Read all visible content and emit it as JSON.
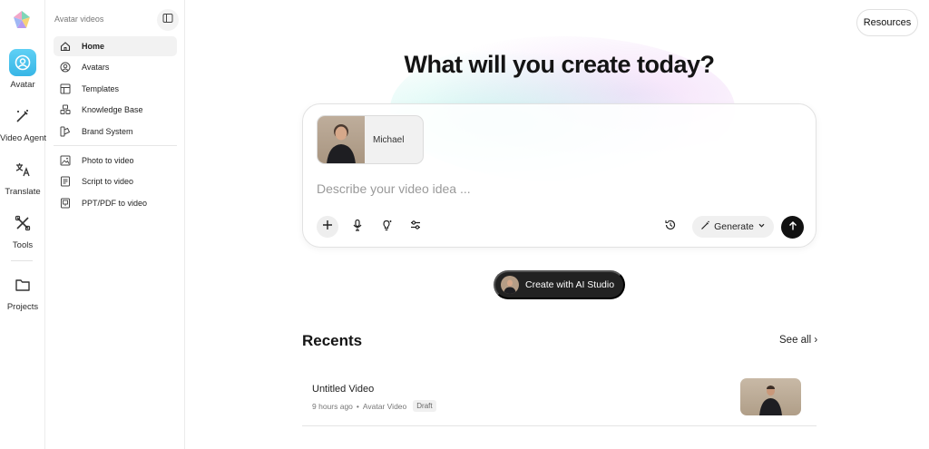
{
  "rail": {
    "items": [
      {
        "label": "Avatar",
        "icon": "avatar-icon"
      },
      {
        "label": "Video Agent",
        "icon": "wand-icon"
      },
      {
        "label": "Translate",
        "icon": "translate-icon"
      },
      {
        "label": "Tools",
        "icon": "tools-icon"
      },
      {
        "label": "Projects",
        "icon": "folder-icon"
      }
    ]
  },
  "sidebar": {
    "title": "Avatar videos",
    "items": [
      {
        "label": "Home",
        "icon": "home-icon"
      },
      {
        "label": "Avatars",
        "icon": "avatars-icon"
      },
      {
        "label": "Templates",
        "icon": "templates-icon"
      },
      {
        "label": "Knowledge Base",
        "icon": "knowledge-icon"
      },
      {
        "label": "Brand System",
        "icon": "brand-icon"
      },
      {
        "label": "Photo to video",
        "icon": "photo-icon"
      },
      {
        "label": "Script to video",
        "icon": "script-icon"
      },
      {
        "label": "PPT/PDF to video",
        "icon": "ppt-icon"
      }
    ]
  },
  "header": {
    "resources_label": "Resources",
    "headline": "What will you create today?"
  },
  "prompt": {
    "avatar_name": "Michael",
    "placeholder": "Describe your video idea ...",
    "generate_label": "Generate"
  },
  "studio": {
    "label": "Create with AI Studio"
  },
  "recents": {
    "title": "Recents",
    "see_all": "See all ›",
    "items": [
      {
        "title": "Untitled Video",
        "age": "9 hours ago",
        "type": "Avatar Video",
        "status": "Draft"
      }
    ]
  },
  "colors": {
    "accent": "#38b6e6",
    "dark_button": "#222222"
  }
}
